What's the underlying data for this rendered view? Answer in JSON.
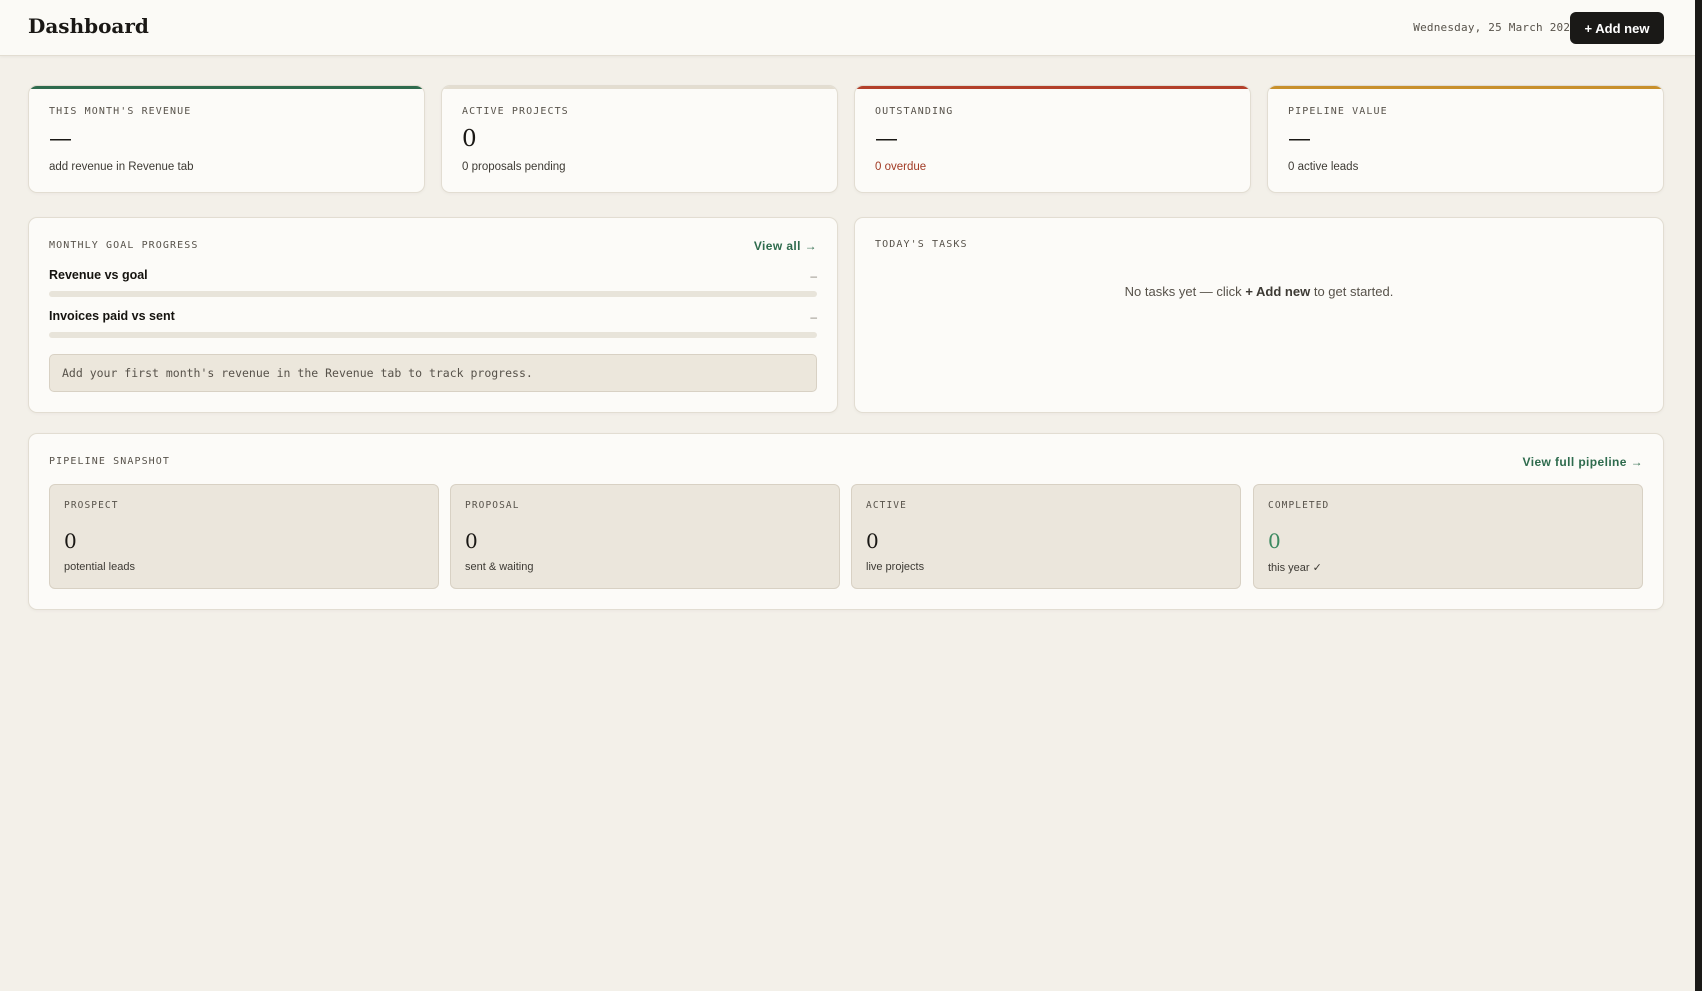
{
  "header": {
    "title": "Dashboard",
    "date": "Wednesday, 25 March 2026",
    "add_button": "+ Add new"
  },
  "stats": [
    {
      "label": "THIS MONTH'S REVENUE",
      "value": "—",
      "sub": "add revenue in Revenue tab",
      "accent": "#2e6b4d"
    },
    {
      "label": "ACTIVE PROJECTS",
      "value": "0",
      "sub": "0 proposals pending",
      "accent": "#e3ddd0"
    },
    {
      "label": "OUTSTANDING",
      "value": "—",
      "sub": "0 overdue",
      "accent": "#b3402a"
    },
    {
      "label": "PIPELINE VALUE",
      "value": "—",
      "sub": "0 active leads",
      "accent": "#c8902c"
    }
  ],
  "goal": {
    "title": "MONTHLY GOAL PROGRESS",
    "view_all": "View all →",
    "rows": [
      {
        "label": "Revenue vs goal",
        "value": "–",
        "progress": 0
      },
      {
        "label": "Invoices paid vs sent",
        "value": "–",
        "progress": 0
      }
    ],
    "hint": "Add your first month's revenue in the Revenue tab to track progress."
  },
  "tasks": {
    "title": "TODAY'S TASKS",
    "empty_pre": "No tasks yet — click",
    "empty_action": "+ Add new",
    "empty_post": "to get started."
  },
  "pipeline": {
    "title": "PIPELINE SNAPSHOT",
    "view_full": "View full pipeline →",
    "stages": [
      {
        "label": "PROSPECT",
        "count": "0",
        "sub": "potential leads"
      },
      {
        "label": "PROPOSAL",
        "count": "0",
        "sub": "sent & waiting"
      },
      {
        "label": "ACTIVE",
        "count": "0",
        "sub": "live projects"
      },
      {
        "label": "COMPLETED",
        "count": "0",
        "sub": "this year ✓"
      }
    ]
  },
  "colors": {
    "accent_green": "#2e6b4d",
    "accent_red": "#b3402a",
    "accent_amber": "#c8902c",
    "button_dark": "#1a1917",
    "background": "#f3f0e9"
  }
}
